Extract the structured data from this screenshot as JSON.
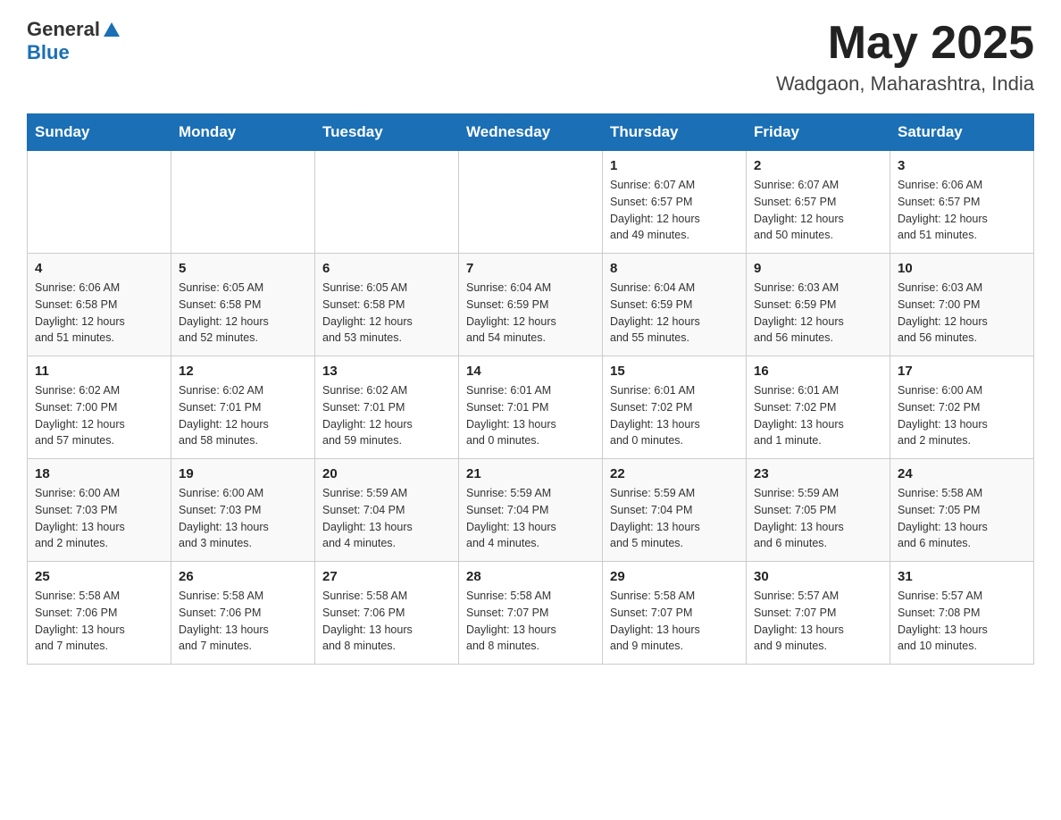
{
  "header": {
    "logo_general": "General",
    "logo_blue": "Blue",
    "month_year": "May 2025",
    "location": "Wadgaon, Maharashtra, India"
  },
  "weekdays": [
    "Sunday",
    "Monday",
    "Tuesday",
    "Wednesday",
    "Thursday",
    "Friday",
    "Saturday"
  ],
  "weeks": [
    [
      {
        "day": "",
        "info": ""
      },
      {
        "day": "",
        "info": ""
      },
      {
        "day": "",
        "info": ""
      },
      {
        "day": "",
        "info": ""
      },
      {
        "day": "1",
        "info": "Sunrise: 6:07 AM\nSunset: 6:57 PM\nDaylight: 12 hours\nand 49 minutes."
      },
      {
        "day": "2",
        "info": "Sunrise: 6:07 AM\nSunset: 6:57 PM\nDaylight: 12 hours\nand 50 minutes."
      },
      {
        "day": "3",
        "info": "Sunrise: 6:06 AM\nSunset: 6:57 PM\nDaylight: 12 hours\nand 51 minutes."
      }
    ],
    [
      {
        "day": "4",
        "info": "Sunrise: 6:06 AM\nSunset: 6:58 PM\nDaylight: 12 hours\nand 51 minutes."
      },
      {
        "day": "5",
        "info": "Sunrise: 6:05 AM\nSunset: 6:58 PM\nDaylight: 12 hours\nand 52 minutes."
      },
      {
        "day": "6",
        "info": "Sunrise: 6:05 AM\nSunset: 6:58 PM\nDaylight: 12 hours\nand 53 minutes."
      },
      {
        "day": "7",
        "info": "Sunrise: 6:04 AM\nSunset: 6:59 PM\nDaylight: 12 hours\nand 54 minutes."
      },
      {
        "day": "8",
        "info": "Sunrise: 6:04 AM\nSunset: 6:59 PM\nDaylight: 12 hours\nand 55 minutes."
      },
      {
        "day": "9",
        "info": "Sunrise: 6:03 AM\nSunset: 6:59 PM\nDaylight: 12 hours\nand 56 minutes."
      },
      {
        "day": "10",
        "info": "Sunrise: 6:03 AM\nSunset: 7:00 PM\nDaylight: 12 hours\nand 56 minutes."
      }
    ],
    [
      {
        "day": "11",
        "info": "Sunrise: 6:02 AM\nSunset: 7:00 PM\nDaylight: 12 hours\nand 57 minutes."
      },
      {
        "day": "12",
        "info": "Sunrise: 6:02 AM\nSunset: 7:01 PM\nDaylight: 12 hours\nand 58 minutes."
      },
      {
        "day": "13",
        "info": "Sunrise: 6:02 AM\nSunset: 7:01 PM\nDaylight: 12 hours\nand 59 minutes."
      },
      {
        "day": "14",
        "info": "Sunrise: 6:01 AM\nSunset: 7:01 PM\nDaylight: 13 hours\nand 0 minutes."
      },
      {
        "day": "15",
        "info": "Sunrise: 6:01 AM\nSunset: 7:02 PM\nDaylight: 13 hours\nand 0 minutes."
      },
      {
        "day": "16",
        "info": "Sunrise: 6:01 AM\nSunset: 7:02 PM\nDaylight: 13 hours\nand 1 minute."
      },
      {
        "day": "17",
        "info": "Sunrise: 6:00 AM\nSunset: 7:02 PM\nDaylight: 13 hours\nand 2 minutes."
      }
    ],
    [
      {
        "day": "18",
        "info": "Sunrise: 6:00 AM\nSunset: 7:03 PM\nDaylight: 13 hours\nand 2 minutes."
      },
      {
        "day": "19",
        "info": "Sunrise: 6:00 AM\nSunset: 7:03 PM\nDaylight: 13 hours\nand 3 minutes."
      },
      {
        "day": "20",
        "info": "Sunrise: 5:59 AM\nSunset: 7:04 PM\nDaylight: 13 hours\nand 4 minutes."
      },
      {
        "day": "21",
        "info": "Sunrise: 5:59 AM\nSunset: 7:04 PM\nDaylight: 13 hours\nand 4 minutes."
      },
      {
        "day": "22",
        "info": "Sunrise: 5:59 AM\nSunset: 7:04 PM\nDaylight: 13 hours\nand 5 minutes."
      },
      {
        "day": "23",
        "info": "Sunrise: 5:59 AM\nSunset: 7:05 PM\nDaylight: 13 hours\nand 6 minutes."
      },
      {
        "day": "24",
        "info": "Sunrise: 5:58 AM\nSunset: 7:05 PM\nDaylight: 13 hours\nand 6 minutes."
      }
    ],
    [
      {
        "day": "25",
        "info": "Sunrise: 5:58 AM\nSunset: 7:06 PM\nDaylight: 13 hours\nand 7 minutes."
      },
      {
        "day": "26",
        "info": "Sunrise: 5:58 AM\nSunset: 7:06 PM\nDaylight: 13 hours\nand 7 minutes."
      },
      {
        "day": "27",
        "info": "Sunrise: 5:58 AM\nSunset: 7:06 PM\nDaylight: 13 hours\nand 8 minutes."
      },
      {
        "day": "28",
        "info": "Sunrise: 5:58 AM\nSunset: 7:07 PM\nDaylight: 13 hours\nand 8 minutes."
      },
      {
        "day": "29",
        "info": "Sunrise: 5:58 AM\nSunset: 7:07 PM\nDaylight: 13 hours\nand 9 minutes."
      },
      {
        "day": "30",
        "info": "Sunrise: 5:57 AM\nSunset: 7:07 PM\nDaylight: 13 hours\nand 9 minutes."
      },
      {
        "day": "31",
        "info": "Sunrise: 5:57 AM\nSunset: 7:08 PM\nDaylight: 13 hours\nand 10 minutes."
      }
    ]
  ]
}
